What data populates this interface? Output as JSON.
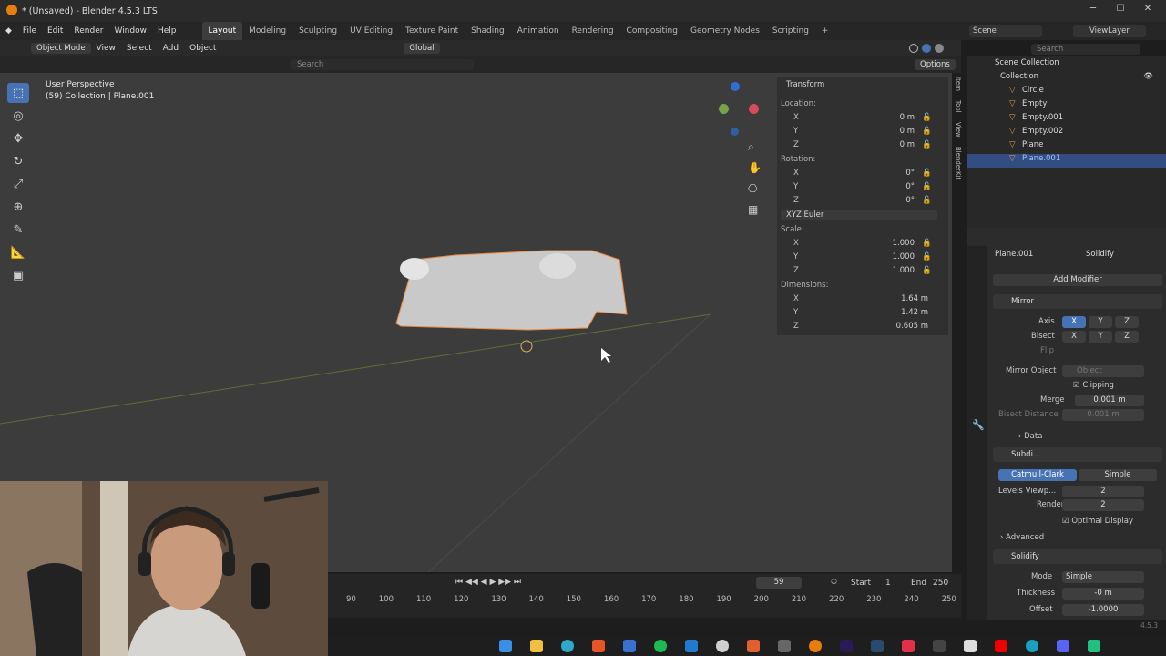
{
  "window": {
    "title": "* (Unsaved) - Blender 4.5.3 LTS"
  },
  "menu": [
    "File",
    "Edit",
    "Render",
    "Window",
    "Help"
  ],
  "workspaces": [
    "Layout",
    "Modeling",
    "Sculpting",
    "UV Editing",
    "Texture Paint",
    "Shading",
    "Animation",
    "Rendering",
    "Compositing",
    "Geometry Nodes",
    "Scripting"
  ],
  "topright": {
    "scene": "Scene",
    "viewlayer": "ViewLayer"
  },
  "header": {
    "mode": "Object Mode",
    "view": "View",
    "select": "Select",
    "add": "Add",
    "object": "Object",
    "orientation": "Global",
    "options": "Options",
    "search": "Search"
  },
  "viewport": {
    "perspective": "User Perspective",
    "collection": "(59) Collection | Plane.001"
  },
  "npanel": {
    "title": "Transform",
    "location_label": "Location:",
    "location": [
      {
        "axis": "X",
        "value": "0 m"
      },
      {
        "axis": "Y",
        "value": "0 m"
      },
      {
        "axis": "Z",
        "value": "0 m"
      }
    ],
    "rotation_label": "Rotation:",
    "rotation": [
      {
        "axis": "X",
        "value": "0°"
      },
      {
        "axis": "Y",
        "value": "0°"
      },
      {
        "axis": "Z",
        "value": "0°"
      }
    ],
    "rotation_mode": "XYZ Euler",
    "scale_label": "Scale:",
    "scale": [
      {
        "axis": "X",
        "value": "1.000"
      },
      {
        "axis": "Y",
        "value": "1.000"
      },
      {
        "axis": "Z",
        "value": "1.000"
      }
    ],
    "dimensions_label": "Dimensions:",
    "dimensions": [
      {
        "axis": "X",
        "value": "1.64 m"
      },
      {
        "axis": "Y",
        "value": "1.42 m"
      },
      {
        "axis": "Z",
        "value": "0.605 m"
      }
    ],
    "tabs": [
      "Item",
      "Tool",
      "View",
      "BlenderKit"
    ]
  },
  "outliner": {
    "root": "Scene Collection",
    "collection": "Collection",
    "items": [
      "Circle",
      "Empty",
      "Empty.001",
      "Empty.002",
      "Plane",
      "Plane.001"
    ],
    "selected": "Plane.001",
    "search": "Search"
  },
  "properties": {
    "object": "Plane.001",
    "modifier_context": "Solidify",
    "add_modifier": "Add Modifier",
    "mirror": {
      "name": "Mirror",
      "axis_label": "Axis",
      "bisect_label": "Bisect",
      "flip_label": "Flip",
      "x": "X",
      "y": "Y",
      "z": "Z",
      "mirror_object_label": "Mirror Object",
      "mirror_object_placeholder": "Object",
      "clipping": "Clipping",
      "merge_label": "Merge",
      "merge_value": "0.001 m",
      "bisect_distance_label": "Bisect Distance",
      "bisect_distance_value": "0.001 m",
      "data": "Data"
    },
    "subdiv": {
      "name": "Subdi...",
      "catmull": "Catmull-Clark",
      "simple": "Simple",
      "levels_label": "Levels Viewp...",
      "levels_value": "2",
      "render_label": "Render",
      "render_value": "2",
      "optimal": "Optimal Display",
      "advanced": "Advanced"
    },
    "solidify": {
      "name": "Solidify",
      "mode_label": "Mode",
      "mode_value": "Simple",
      "thickness_label": "Thickness",
      "thickness_value": "-0 m",
      "offset_label": "Offset",
      "offset_value": "-1.0000"
    }
  },
  "timeline": {
    "frame": "59",
    "start_label": "Start",
    "start": "1",
    "end_label": "End",
    "end": "250",
    "ticks": [
      "90",
      "100",
      "110",
      "120",
      "130",
      "140",
      "150",
      "160",
      "170",
      "180",
      "190",
      "200",
      "210",
      "220",
      "230",
      "240",
      "250"
    ]
  },
  "statusbar": {
    "version": "4.5.3"
  },
  "colors": {
    "accent": "#4772b3",
    "selection": "#f0883a",
    "bg": "#3c3c3c"
  }
}
